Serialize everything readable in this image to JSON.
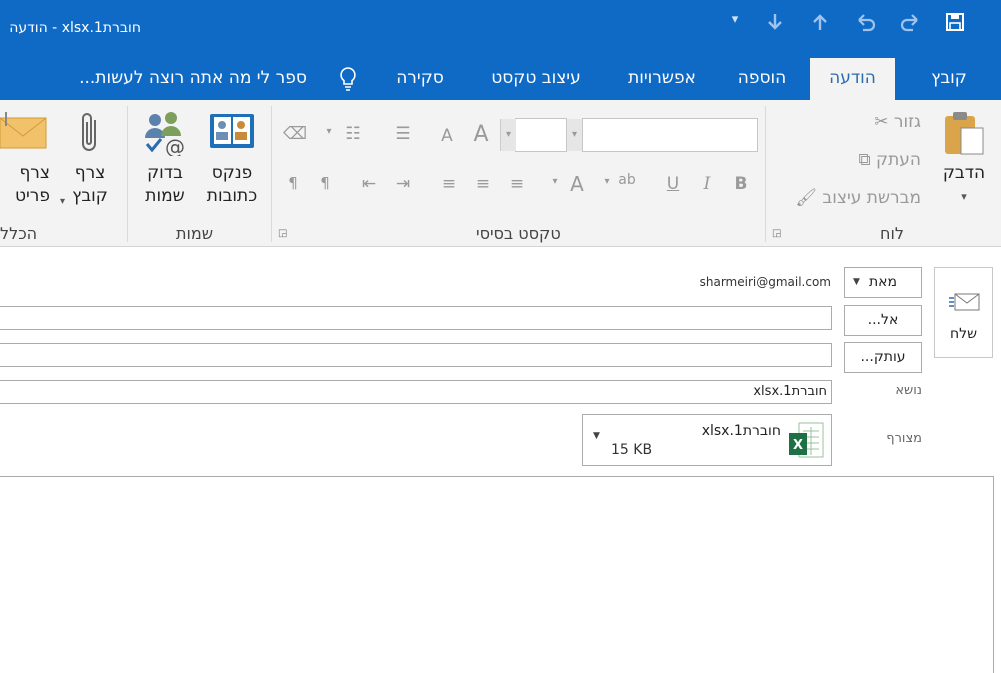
{
  "window": {
    "title": "חוברת1.xlsx - הודעה"
  },
  "qat": {
    "save_icon": "save-icon",
    "redo_icon": "redo-icon",
    "undo_icon": "undo-icon",
    "up_icon": "arrow-up-icon",
    "down_icon": "arrow-down-icon",
    "customize": "▾"
  },
  "tabs": [
    {
      "label": "קובץ"
    },
    {
      "label": "הודעה"
    },
    {
      "label": "הוספה"
    },
    {
      "label": "אפשרויות"
    },
    {
      "label": "עיצוב טקסט"
    },
    {
      "label": "סקירה"
    },
    {
      "label": "ספר לי מה אתה רוצה לעשות..."
    }
  ],
  "ribbon": {
    "clipboard": {
      "paste": "הדבק",
      "cut": "גזור",
      "copy": "העתק",
      "format_painter": "מברשת עיצוב",
      "group_label": "לוח"
    },
    "basic_text": {
      "group_label": "טקסט בסיסי",
      "bold": "B",
      "italic": "I",
      "underline": "U",
      "font_color": "A",
      "grow": "A",
      "shrink": "A"
    },
    "names": {
      "address_book_line1": "פנקס",
      "address_book_line2": "כתובות",
      "check_names_line1": "בדוק",
      "check_names_line2": "שמות",
      "group_label": "שמות"
    },
    "include": {
      "attach_file_line1": "צרף",
      "attach_file_line2": "קובץ",
      "attach_item_line1": "צרף",
      "attach_item_line2": "פריט",
      "group_label": "הכלל"
    }
  },
  "compose": {
    "send": "שלח",
    "from_button": "מאת",
    "from_value": "sharmeiri@gmail.com",
    "to_button": "אל...",
    "cc_button": "עותק...",
    "subject_label": "נושא",
    "subject_value": "חוברת1.xlsx",
    "attached_label": "מצורף",
    "attachment_name": "חוברת1.xlsx",
    "attachment_size": "15 KB"
  },
  "colors": {
    "accent": "#0f6ac6",
    "ribbon_bg": "#f3f3f3",
    "excel_green": "#1e7145"
  }
}
